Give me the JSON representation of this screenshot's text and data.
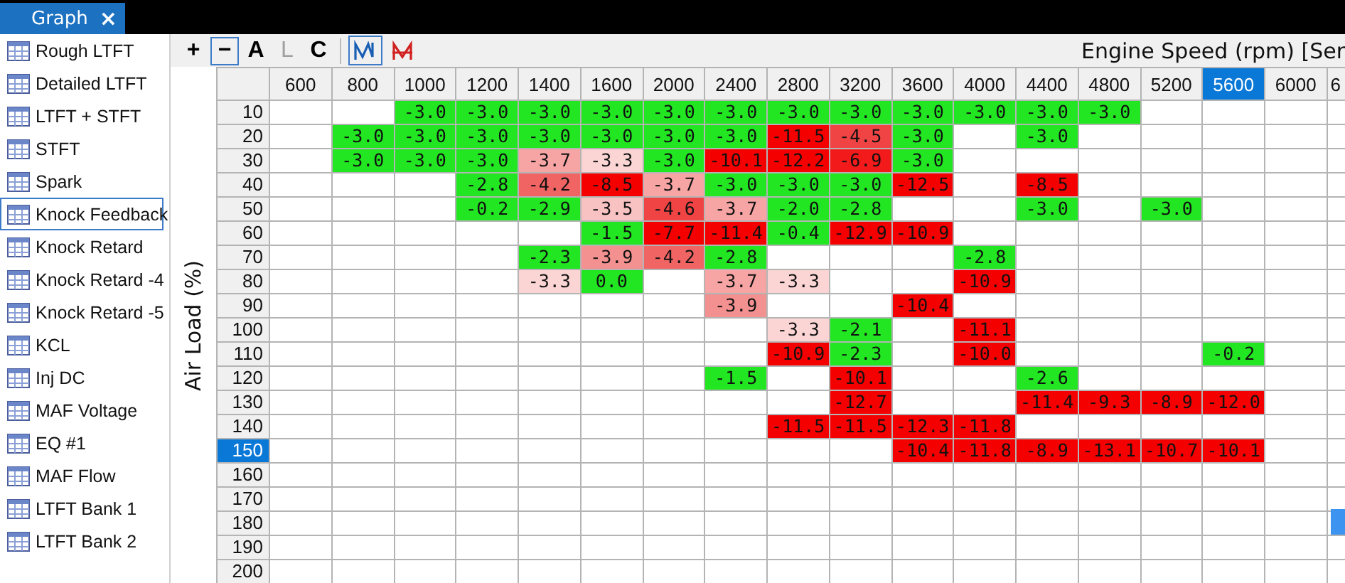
{
  "tabs": [
    {
      "label": "Graph",
      "close": "×",
      "selected": true
    }
  ],
  "sidebar": {
    "items": [
      {
        "label": "Rough LTFT",
        "selected": false
      },
      {
        "label": "Detailed LTFT",
        "selected": false
      },
      {
        "label": "LTFT + STFT",
        "selected": false
      },
      {
        "label": "STFT",
        "selected": false
      },
      {
        "label": "Spark",
        "selected": false
      },
      {
        "label": "Knock Feedback",
        "selected": true
      },
      {
        "label": "Knock Retard",
        "selected": false
      },
      {
        "label": "Knock Retard -4",
        "selected": false
      },
      {
        "label": "Knock Retard -5",
        "selected": false
      },
      {
        "label": "KCL",
        "selected": false
      },
      {
        "label": "Inj DC",
        "selected": false
      },
      {
        "label": "MAF Voltage",
        "selected": false
      },
      {
        "label": "EQ #1",
        "selected": false
      },
      {
        "label": "MAF Flow",
        "selected": false
      },
      {
        "label": "LTFT Bank 1",
        "selected": false
      },
      {
        "label": "LTFT Bank 2",
        "selected": false
      }
    ]
  },
  "toolbar": {
    "buttons": [
      {
        "label": "+",
        "selected": false,
        "disabled": false
      },
      {
        "label": "−",
        "selected": true,
        "disabled": false
      },
      {
        "label": "A",
        "selected": false,
        "disabled": false
      },
      {
        "label": "L",
        "selected": false,
        "disabled": true
      },
      {
        "label": "C",
        "selected": false,
        "disabled": false
      }
    ],
    "view_buttons": [
      {
        "selected": true
      },
      {
        "selected": false
      }
    ]
  },
  "table": {
    "x_axis_title": "Engine Speed (rpm) [Ser",
    "y_axis_title": "Air Load (%)",
    "columns": [
      {
        "label": "600",
        "selected": false
      },
      {
        "label": "800",
        "selected": false
      },
      {
        "label": "1000",
        "selected": false
      },
      {
        "label": "1200",
        "selected": false
      },
      {
        "label": "1400",
        "selected": false
      },
      {
        "label": "1600",
        "selected": false
      },
      {
        "label": "2000",
        "selected": false
      },
      {
        "label": "2400",
        "selected": false
      },
      {
        "label": "2800",
        "selected": false
      },
      {
        "label": "3200",
        "selected": false
      },
      {
        "label": "3600",
        "selected": false
      },
      {
        "label": "4000",
        "selected": false
      },
      {
        "label": "4400",
        "selected": false
      },
      {
        "label": "4800",
        "selected": false
      },
      {
        "label": "5200",
        "selected": false
      },
      {
        "label": "5600",
        "selected": true
      },
      {
        "label": "6000",
        "selected": false
      },
      {
        "label": "6",
        "selected": false
      }
    ],
    "rows": [
      {
        "label": "10",
        "selected": false,
        "cells": [
          null,
          null,
          {
            "value": "-3.0",
            "color": "#22e622"
          },
          {
            "value": "-3.0",
            "color": "#22e622"
          },
          {
            "value": "-3.0",
            "color": "#22e622"
          },
          {
            "value": "-3.0",
            "color": "#22e622"
          },
          {
            "value": "-3.0",
            "color": "#22e622"
          },
          {
            "value": "-3.0",
            "color": "#22e622"
          },
          {
            "value": "-3.0",
            "color": "#22e622"
          },
          {
            "value": "-3.0",
            "color": "#22e622"
          },
          {
            "value": "-3.0",
            "color": "#22e622"
          },
          {
            "value": "-3.0",
            "color": "#22e622"
          },
          {
            "value": "-3.0",
            "color": "#22e622"
          },
          {
            "value": "-3.0",
            "color": "#22e622"
          },
          null,
          null,
          null
        ]
      },
      {
        "label": "20",
        "selected": false,
        "cells": [
          null,
          {
            "value": "-3.0",
            "color": "#22e622"
          },
          {
            "value": "-3.0",
            "color": "#22e622"
          },
          {
            "value": "-3.0",
            "color": "#22e622"
          },
          {
            "value": "-3.0",
            "color": "#22e622"
          },
          {
            "value": "-3.0",
            "color": "#22e622"
          },
          {
            "value": "-3.0",
            "color": "#22e622"
          },
          {
            "value": "-3.0",
            "color": "#22e622"
          },
          {
            "value": "-11.5",
            "color": "#f50000"
          },
          {
            "value": "-4.5",
            "color": "#f04444"
          },
          {
            "value": "-3.0",
            "color": "#22e622"
          },
          null,
          {
            "value": "-3.0",
            "color": "#22e622"
          },
          null,
          null,
          null,
          null
        ]
      },
      {
        "label": "30",
        "selected": false,
        "cells": [
          null,
          {
            "value": "-3.0",
            "color": "#22e622"
          },
          {
            "value": "-3.0",
            "color": "#22e622"
          },
          {
            "value": "-3.0",
            "color": "#22e622"
          },
          {
            "value": "-3.7",
            "color": "#f7a4a4"
          },
          {
            "value": "-3.3",
            "color": "#fbd4d4"
          },
          {
            "value": "-3.0",
            "color": "#22e622"
          },
          {
            "value": "-10.1",
            "color": "#f50000"
          },
          {
            "value": "-12.2",
            "color": "#f50000"
          },
          {
            "value": "-6.9",
            "color": "#f21a1a"
          },
          {
            "value": "-3.0",
            "color": "#22e622"
          },
          null,
          null,
          null,
          null,
          null,
          null
        ]
      },
      {
        "label": "40",
        "selected": false,
        "cells": [
          null,
          null,
          null,
          {
            "value": "-2.8",
            "color": "#22e622"
          },
          {
            "value": "-4.2",
            "color": "#f06464"
          },
          {
            "value": "-8.5",
            "color": "#f50000"
          },
          {
            "value": "-3.7",
            "color": "#f7a4a4"
          },
          {
            "value": "-3.0",
            "color": "#22e622"
          },
          {
            "value": "-3.0",
            "color": "#22e622"
          },
          {
            "value": "-3.0",
            "color": "#22e622"
          },
          {
            "value": "-12.5",
            "color": "#f50000"
          },
          null,
          {
            "value": "-8.5",
            "color": "#f50000"
          },
          null,
          null,
          null,
          null
        ]
      },
      {
        "label": "50",
        "selected": false,
        "cells": [
          null,
          null,
          null,
          {
            "value": "-0.2",
            "color": "#22e622"
          },
          {
            "value": "-2.9",
            "color": "#22e622"
          },
          {
            "value": "-3.5",
            "color": "#f9c2c2"
          },
          {
            "value": "-4.6",
            "color": "#f04444"
          },
          {
            "value": "-3.7",
            "color": "#f7a4a4"
          },
          {
            "value": "-2.0",
            "color": "#22e622"
          },
          {
            "value": "-2.8",
            "color": "#22e622"
          },
          null,
          null,
          {
            "value": "-3.0",
            "color": "#22e622"
          },
          null,
          {
            "value": "-3.0",
            "color": "#22e622"
          },
          null,
          null
        ]
      },
      {
        "label": "60",
        "selected": false,
        "cells": [
          null,
          null,
          null,
          null,
          null,
          {
            "value": "-1.5",
            "color": "#22e622"
          },
          {
            "value": "-7.7",
            "color": "#f50000"
          },
          {
            "value": "-11.4",
            "color": "#f50000"
          },
          {
            "value": "-0.4",
            "color": "#22e622"
          },
          {
            "value": "-12.9",
            "color": "#f50000"
          },
          {
            "value": "-10.9",
            "color": "#f50000"
          },
          null,
          null,
          null,
          null,
          null,
          null
        ]
      },
      {
        "label": "70",
        "selected": false,
        "cells": [
          null,
          null,
          null,
          null,
          {
            "value": "-2.3",
            "color": "#22e622"
          },
          {
            "value": "-3.9",
            "color": "#f39090"
          },
          {
            "value": "-4.2",
            "color": "#f06464"
          },
          {
            "value": "-2.8",
            "color": "#22e622"
          },
          null,
          null,
          null,
          {
            "value": "-2.8",
            "color": "#22e622"
          },
          null,
          null,
          null,
          null,
          null
        ]
      },
      {
        "label": "80",
        "selected": false,
        "cells": [
          null,
          null,
          null,
          null,
          {
            "value": "-3.3",
            "color": "#fbd4d4"
          },
          {
            "value": "0.0",
            "color": "#22e622"
          },
          null,
          {
            "value": "-3.7",
            "color": "#f7a4a4"
          },
          {
            "value": "-3.3",
            "color": "#fbd4d4"
          },
          null,
          null,
          {
            "value": "-10.9",
            "color": "#f50000"
          },
          null,
          null,
          null,
          null,
          null
        ]
      },
      {
        "label": "90",
        "selected": false,
        "cells": [
          null,
          null,
          null,
          null,
          null,
          null,
          null,
          {
            "value": "-3.9",
            "color": "#f39090"
          },
          null,
          null,
          {
            "value": "-10.4",
            "color": "#f50000"
          },
          null,
          null,
          null,
          null,
          null,
          null
        ]
      },
      {
        "label": "100",
        "selected": false,
        "cells": [
          null,
          null,
          null,
          null,
          null,
          null,
          null,
          null,
          {
            "value": "-3.3",
            "color": "#fbd4d4"
          },
          {
            "value": "-2.1",
            "color": "#22e622"
          },
          null,
          {
            "value": "-11.1",
            "color": "#f50000"
          },
          null,
          null,
          null,
          null,
          null
        ]
      },
      {
        "label": "110",
        "selected": false,
        "cells": [
          null,
          null,
          null,
          null,
          null,
          null,
          null,
          null,
          {
            "value": "-10.9",
            "color": "#f50000"
          },
          {
            "value": "-2.3",
            "color": "#22e622"
          },
          null,
          {
            "value": "-10.0",
            "color": "#f50000"
          },
          null,
          null,
          null,
          {
            "value": "-0.2",
            "color": "#22e622"
          },
          null
        ]
      },
      {
        "label": "120",
        "selected": false,
        "cells": [
          null,
          null,
          null,
          null,
          null,
          null,
          null,
          {
            "value": "-1.5",
            "color": "#22e622"
          },
          null,
          {
            "value": "-10.1",
            "color": "#f50000"
          },
          null,
          null,
          {
            "value": "-2.6",
            "color": "#22e622"
          },
          null,
          null,
          null,
          null
        ]
      },
      {
        "label": "130",
        "selected": false,
        "cells": [
          null,
          null,
          null,
          null,
          null,
          null,
          null,
          null,
          null,
          {
            "value": "-12.7",
            "color": "#f50000"
          },
          null,
          null,
          {
            "value": "-11.4",
            "color": "#f50000"
          },
          {
            "value": "-9.3",
            "color": "#f50000"
          },
          {
            "value": "-8.9",
            "color": "#f50000"
          },
          {
            "value": "-12.0",
            "color": "#f50000"
          },
          null
        ]
      },
      {
        "label": "140",
        "selected": false,
        "cells": [
          null,
          null,
          null,
          null,
          null,
          null,
          null,
          null,
          {
            "value": "-11.5",
            "color": "#f50000"
          },
          {
            "value": "-11.5",
            "color": "#f50000"
          },
          {
            "value": "-12.3",
            "color": "#f50000"
          },
          {
            "value": "-11.8",
            "color": "#f50000"
          },
          null,
          null,
          null,
          null,
          null
        ]
      },
      {
        "label": "150",
        "selected": true,
        "cells": [
          null,
          null,
          null,
          null,
          null,
          null,
          null,
          null,
          null,
          null,
          {
            "value": "-10.4",
            "color": "#f50000"
          },
          {
            "value": "-11.8",
            "color": "#f50000"
          },
          {
            "value": "-8.9",
            "color": "#f50000"
          },
          {
            "value": "-13.1",
            "color": "#f50000"
          },
          {
            "value": "-10.7",
            "color": "#f50000"
          },
          {
            "value": "-10.1",
            "color": "#f50000"
          },
          null
        ]
      },
      {
        "label": "160",
        "selected": false,
        "cells": []
      },
      {
        "label": "170",
        "selected": false,
        "cells": []
      },
      {
        "label": "180",
        "selected": false,
        "cells": []
      },
      {
        "label": "190",
        "selected": false,
        "cells": []
      },
      {
        "label": "200",
        "selected": false,
        "cells": []
      }
    ]
  }
}
